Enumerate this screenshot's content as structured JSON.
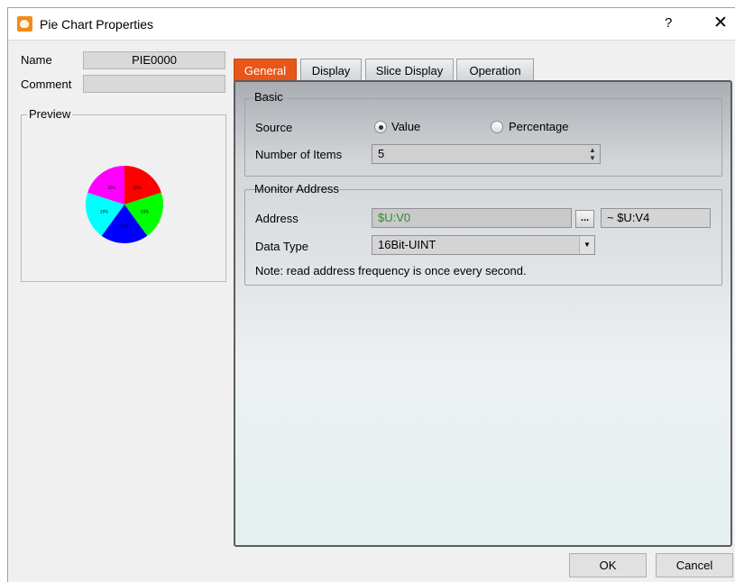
{
  "window": {
    "title": "Pie Chart Properties",
    "help_label": "?",
    "close_label": "✕"
  },
  "left": {
    "name_label": "Name",
    "name_value": "PIE0000",
    "comment_label": "Comment",
    "comment_value": "",
    "preview_label": "Preview"
  },
  "preview_pie": {
    "colors": [
      "#ff0000",
      "#00ff00",
      "#0000ff",
      "#00ffff",
      "#ff00ff"
    ],
    "slice_labels": [
      "20%",
      "20%",
      "20%",
      "20%",
      "20%"
    ]
  },
  "tabs": [
    {
      "label": "General",
      "active": true
    },
    {
      "label": "Display",
      "active": false
    },
    {
      "label": "Slice Display",
      "active": false
    },
    {
      "label": "Operation",
      "active": false
    }
  ],
  "basic": {
    "title": "Basic",
    "source_label": "Source",
    "source_options": [
      "Value",
      "Percentage"
    ],
    "source_selected": "Value",
    "items_label": "Number of Items",
    "items_value": "5",
    "spin_up": "▲",
    "spin_down": "▼"
  },
  "monitor": {
    "title": "Monitor Address",
    "address_label": "Address",
    "address_value": "$U:V0",
    "address_value_color": "#2e8b2e",
    "browse_label": "...",
    "address_end": "~ $U:V4",
    "datatype_label": "Data Type",
    "datatype_value": "16Bit-UINT",
    "dropdown_arrow": "▼",
    "note": "Note: read address frequency is once every second."
  },
  "footer": {
    "ok_label": "OK",
    "cancel_label": "Cancel"
  },
  "colors": {
    "active_tab": "#e8561a"
  }
}
